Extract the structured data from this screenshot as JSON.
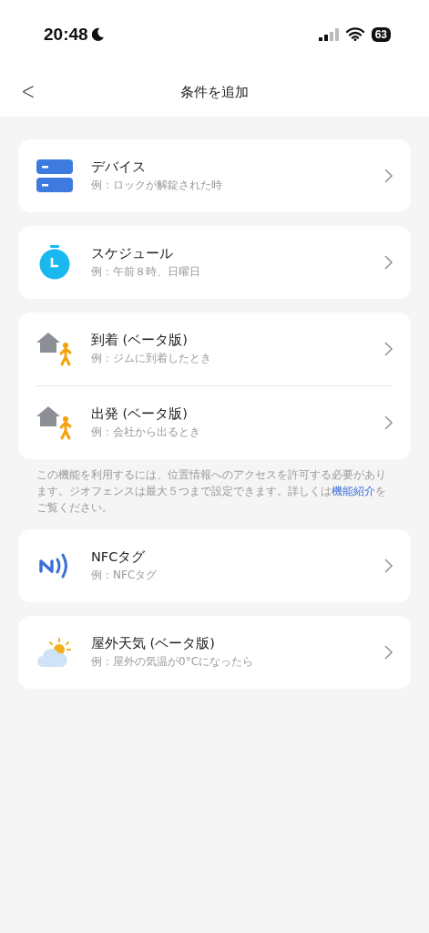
{
  "status_bar": {
    "time": "20:48",
    "battery": "63"
  },
  "header": {
    "back": "<",
    "title": "条件を追加"
  },
  "groups": [
    {
      "items": [
        {
          "kind": "device",
          "title": "デバイス",
          "subtitle": "例：ロックが解錠された時"
        }
      ]
    },
    {
      "items": [
        {
          "kind": "schedule",
          "title": "スケジュール",
          "subtitle": "例：午前８時、日曜日"
        }
      ]
    },
    {
      "items": [
        {
          "kind": "arrive",
          "title": "到着 (ベータ版)",
          "subtitle": "例：ジムに到着したとき"
        },
        {
          "kind": "leave",
          "title": "出発 (ベータ版)",
          "subtitle": "例：会社から出るとき"
        }
      ],
      "note": {
        "before": "この機能を利用するには、位置情報へのアクセスを許可する必要があります。ジオフェンスは最大５つまで設定できます。詳しくは",
        "link": "機能紹介",
        "after": "をご覧ください。"
      }
    },
    {
      "items": [
        {
          "kind": "nfc",
          "title": "NFCタグ",
          "subtitle": "例：NFCタグ"
        }
      ]
    },
    {
      "items": [
        {
          "kind": "weather",
          "title": "屋外天気 (ベータ版)",
          "subtitle": "例：屋外の気温が0°Cになったら"
        }
      ]
    }
  ]
}
